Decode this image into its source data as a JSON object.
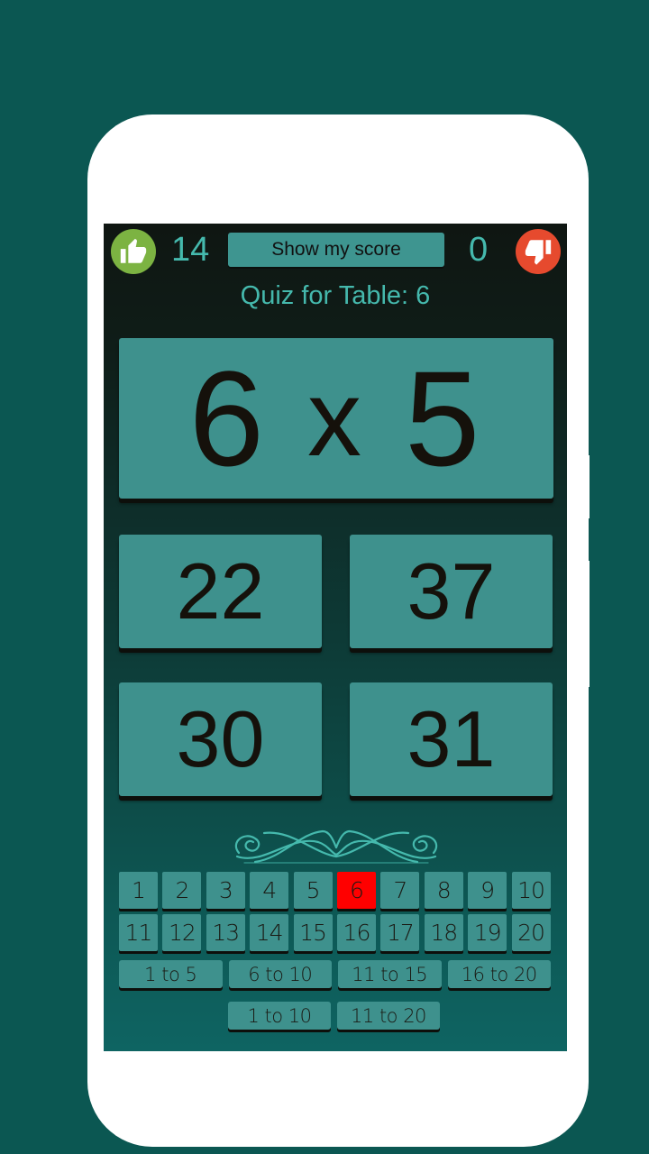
{
  "header": {
    "correct_icon": "thumbs-up-icon",
    "correct_count": "14",
    "show_score_label": "Show my score",
    "wrong_count": "0",
    "wrong_icon": "thumbs-down-icon"
  },
  "quiz": {
    "title": "Quiz for Table: 6",
    "question": {
      "left": "6",
      "operator": "x",
      "right": "5"
    },
    "answers": [
      "22",
      "37",
      "30",
      "31"
    ]
  },
  "tables": {
    "numbers": [
      "1",
      "2",
      "3",
      "4",
      "5",
      "6",
      "7",
      "8",
      "9",
      "10",
      "11",
      "12",
      "13",
      "14",
      "15",
      "16",
      "17",
      "18",
      "19",
      "20"
    ],
    "selected": "6",
    "ranges": [
      "1 to 5",
      "6 to 10",
      "11 to 15",
      "16 to 20"
    ],
    "combined_ranges": [
      "1 to 10",
      "11 to 20"
    ]
  },
  "colors": {
    "accent": "#45b9ad",
    "tile": "#3e918d",
    "selected": "#ff0000",
    "correct": "#7cb342",
    "wrong": "#e64a2e",
    "frame_bg": "#0b5752"
  }
}
